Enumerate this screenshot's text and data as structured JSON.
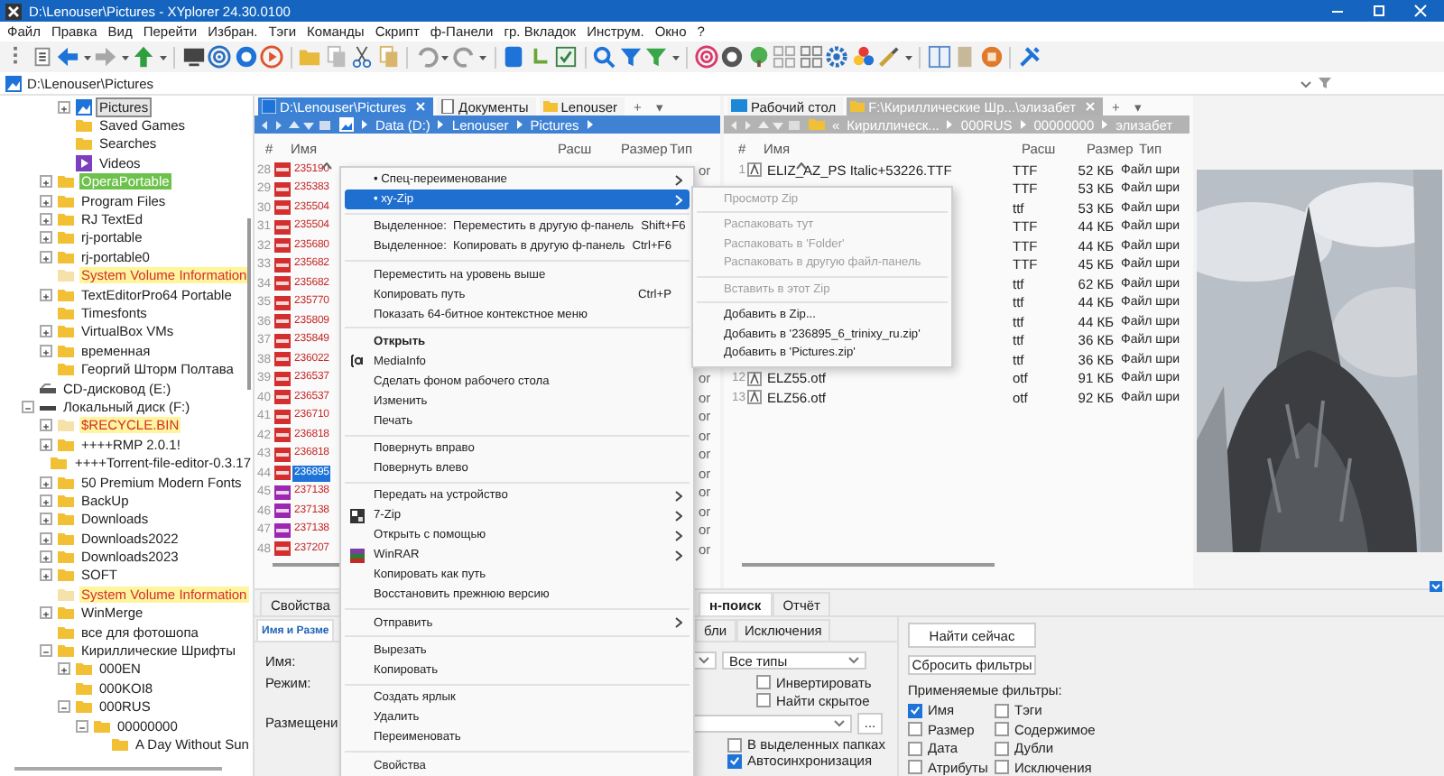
{
  "window": {
    "title": "D:\\Lenouser\\Pictures - XYplorer 24.30.0100"
  },
  "menu": [
    "Файл",
    "Правка",
    "Вид",
    "Перейти",
    "Избран.",
    "Тэги",
    "Команды",
    "Скрипт",
    "ф-Панели",
    "гр. Вкладок",
    "Инструм.",
    "Окно",
    "?"
  ],
  "address": "D:\\Lenouser\\Pictures",
  "tree": [
    {
      "children": [
        {
          "children": [
            {
              "label": "Pictures",
              "kind": "pictures",
              "expanded": false,
              "selected": true
            },
            {
              "label": "Saved Games",
              "kind": "folder",
              "selected": false
            },
            {
              "label": "Searches",
              "kind": "folder",
              "selected": false
            },
            {
              "label": "Videos",
              "kind": "videos",
              "selected": false
            }
          ]
        },
        {
          "label": "OperaPortable",
          "kind": "labeled",
          "color": "#6cc24a",
          "expanded": false,
          "selected": false
        },
        {
          "label": "Program Files",
          "kind": "folder",
          "expanded": false,
          "selected": false
        },
        {
          "label": "RJ TextEd",
          "kind": "folder",
          "expanded": false,
          "selected": false
        },
        {
          "label": "rj-portable",
          "kind": "folder",
          "expanded": false,
          "selected": false
        },
        {
          "label": "rj-portable0",
          "kind": "folder",
          "expanded": false,
          "selected": false
        },
        {
          "label": "System Volume Information",
          "kind": "system",
          "color": "#fff59d",
          "selected": false
        },
        {
          "label": "TextEditorPro64 Portable",
          "kind": "folder",
          "expanded": false,
          "selected": false
        },
        {
          "label": "Timesfonts",
          "kind": "folder",
          "selected": false
        },
        {
          "label": "VirtualBox VMs",
          "kind": "folder",
          "expanded": false,
          "selected": false
        },
        {
          "label": "временная",
          "kind": "folder",
          "expanded": false,
          "selected": false
        },
        {
          "label": "Георгий Шторм Полтава",
          "kind": "folder",
          "selected": false
        }
      ]
    },
    {
      "label": "CD-дисковод (E:)",
      "kind": "cd",
      "selected": false
    },
    {
      "label": "Локальный диск (F:)",
      "kind": "disk",
      "expanded": true,
      "selected": false,
      "children": [
        {
          "label": "$RECYCLE.BIN",
          "kind": "system",
          "color": "#fff59d",
          "expanded": false,
          "selected": false
        },
        {
          "label": "++++RMP 2.0.1!",
          "kind": "folder",
          "expanded": false,
          "selected": false
        },
        {
          "label": "++++Torrent-file-editor-0.3.17",
          "kind": "folder",
          "selected": false
        },
        {
          "label": "50 Premium Modern Fonts",
          "kind": "folder",
          "expanded": false,
          "selected": false
        },
        {
          "label": "BackUp",
          "kind": "folder",
          "expanded": false,
          "selected": false
        },
        {
          "label": "Downloads",
          "kind": "folder",
          "expanded": false,
          "selected": false
        },
        {
          "label": "Downloads2022",
          "kind": "folder",
          "expanded": false,
          "selected": false
        },
        {
          "label": "Downloads2023",
          "kind": "folder",
          "expanded": false,
          "selected": false
        },
        {
          "label": "SOFT",
          "kind": "folder",
          "expanded": false,
          "selected": false
        },
        {
          "label": "System Volume Information",
          "kind": "system",
          "color": "#fff59d",
          "selected": false
        },
        {
          "label": "WinMerge",
          "kind": "folder",
          "expanded": false,
          "selected": false
        },
        {
          "label": "все для фотошопа",
          "kind": "folder",
          "selected": false
        },
        {
          "label": "Кириллические Шрифты",
          "kind": "folder",
          "expanded": true,
          "selected": false,
          "children": [
            {
              "label": "000EN",
              "kind": "folder",
              "expanded": false,
              "selected": false
            },
            {
              "label": "000KOI8",
              "kind": "folder",
              "selected": false
            },
            {
              "label": "000RUS",
              "kind": "folder",
              "expanded": true,
              "selected": false,
              "children": [
                {
                  "label": "00000000",
                  "kind": "folder",
                  "expanded": true,
                  "selected": false,
                  "children": [
                    {
                      "label": "A Day Without Sun",
                      "kind": "folder",
                      "selected": false
                    }
                  ]
                }
              ]
            }
          ]
        }
      ]
    }
  ],
  "left_pane": {
    "tabs": [
      {
        "label": "D:\\Lenouser\\Pictures",
        "selected": true
      },
      {
        "label": "Документы",
        "selected": false
      },
      {
        "label": "Lenouser",
        "selected": false
      }
    ],
    "new_tab": "+",
    "tab_menu": "▾",
    "breadcrumb": {
      "crumbs": [
        "Data (D:)",
        "Lenouser",
        "Pictures"
      ],
      "trailing_arrow": true
    },
    "columns": [
      "#",
      "Имя",
      "Расш",
      "Размер",
      "Тип"
    ],
    "rows": [
      {
        "num": "28",
        "name": "235190",
        "color": "#d32f2f",
        "type": "or",
        "selected": false
      },
      {
        "num": "29",
        "name": "235383",
        "color": "#d32f2f",
        "selected": false
      },
      {
        "num": "30",
        "name": "235504",
        "color": "#d32f2f",
        "selected": false
      },
      {
        "num": "31",
        "name": "235504",
        "color": "#d32f2f",
        "selected": false
      },
      {
        "num": "32",
        "name": "235680",
        "color": "#d32f2f",
        "selected": false
      },
      {
        "num": "33",
        "name": "235682",
        "color": "#d32f2f",
        "selected": false
      },
      {
        "num": "34",
        "name": "235682",
        "color": "#d32f2f",
        "selected": false
      },
      {
        "num": "35",
        "name": "235770",
        "color": "#d32f2f",
        "selected": false
      },
      {
        "num": "36",
        "name": "235809",
        "color": "#d32f2f",
        "selected": false
      },
      {
        "num": "37",
        "name": "235849",
        "color": "#d32f2f",
        "selected": false
      },
      {
        "num": "38",
        "name": "236022",
        "color": "#d32f2f",
        "selected": false
      },
      {
        "num": "39",
        "name": "236537",
        "color": "#d32f2f",
        "type": "or",
        "selected": false
      },
      {
        "num": "40",
        "name": "236537",
        "color": "#d32f2f",
        "type": "or",
        "selected": false
      },
      {
        "num": "41",
        "name": "236710",
        "color": "#d32f2f",
        "type": "or",
        "selected": false
      },
      {
        "num": "42",
        "name": "236818",
        "color": "#d32f2f",
        "type": "or",
        "selected": false
      },
      {
        "num": "43",
        "name": "236818",
        "color": "#d32f2f",
        "type": "or",
        "selected": false
      },
      {
        "num": "44",
        "name": "236895",
        "color": "#d32f2f",
        "type": "or",
        "selected": true
      },
      {
        "num": "45",
        "name": "237138",
        "color": "#9c27b0",
        "type": "or",
        "selected": false
      },
      {
        "num": "46",
        "name": "237138",
        "color": "#9c27b0",
        "type": "or",
        "selected": false
      },
      {
        "num": "47",
        "name": "237138",
        "color": "#9c27b0",
        "type": "or",
        "selected": false
      },
      {
        "num": "48",
        "name": "237207",
        "color": "#d32f2f",
        "type": "or",
        "selected": false
      }
    ]
  },
  "right_pane": {
    "tabs": [
      {
        "label": "Рабочий стол",
        "selected": false
      },
      {
        "label": "F:\\Кириллические Шр...\\элизабет",
        "selected": true
      }
    ],
    "new_tab": "+",
    "tab_menu": "▾",
    "breadcrumb": {
      "overflow": "«",
      "crumbs": [
        "Кириллическ...",
        "000RUS",
        "00000000",
        "элизабет"
      ],
      "trailing_arrow": false
    },
    "columns": [
      "#",
      "Имя",
      "Расш",
      "Размер",
      "Тип"
    ],
    "rows": [
      {
        "num": "1",
        "name": "ELIZ_AZ_PS Italic+53226.TTF",
        "ext": "TTF",
        "size": "52 КБ",
        "type": "Файл шри"
      },
      {
        "ext": "TTF",
        "size": "53 КБ",
        "type": "Файл шри"
      },
      {
        "ext": "ttf",
        "size": "53 КБ",
        "type": "Файл шри"
      },
      {
        "ext": "TTF",
        "size": "44 КБ",
        "type": "Файл шри"
      },
      {
        "ext": "TTF",
        "size": "44 КБ",
        "type": "Файл шри"
      },
      {
        "ext": "TTF",
        "size": "45 КБ",
        "type": "Файл шри"
      },
      {
        "ext": "ttf",
        "size": "62 КБ",
        "type": "Файл шри"
      },
      {
        "ext": "ttf",
        "size": "44 КБ",
        "type": "Файл шри"
      },
      {
        "ext": "ttf",
        "size": "44 КБ",
        "type": "Файл шри"
      },
      {
        "ext": "ttf",
        "size": "36 КБ",
        "type": "Файл шри"
      },
      {
        "ext": "ttf",
        "size": "36 КБ",
        "type": "Файл шри"
      },
      {
        "num": "12",
        "name": "ELZ55.otf",
        "ext": "otf",
        "size": "91 КБ",
        "type": "Файл шри"
      },
      {
        "num": "13",
        "name": "ELZ56.otf",
        "ext": "otf",
        "size": "92 КБ",
        "type": "Файл шри"
      }
    ]
  },
  "bottom_panel": {
    "tabs": [
      {
        "label": "Свойства",
        "selected": false
      },
      {
        "label": "н-поиск",
        "selected": true
      },
      {
        "label": "Отчёт",
        "selected": false
      }
    ],
    "subtabs": [
      {
        "label": "Имя и Разме",
        "selected": true
      },
      {
        "label": "бли",
        "selected": false
      },
      {
        "label": "Исключения",
        "selected": false
      }
    ],
    "labels": [
      "Имя:",
      "Режим:",
      "Размещени"
    ],
    "type_select": "Все типы",
    "options": [
      {
        "label": "Инвертировать",
        "checked": false
      },
      {
        "label": "Найти скрытое",
        "checked": false
      }
    ],
    "browse_button": "...",
    "location_options": [
      {
        "label": "В выделенных папках",
        "checked": false
      },
      {
        "label": "Автосинхронизация",
        "checked": true
      }
    ],
    "buttons": [
      "Найти сейчас",
      "Сбросить фильтры"
    ],
    "filters_title": "Применяемые фильтры:",
    "filters": [
      {
        "label": "Имя",
        "checked": true
      },
      {
        "label": "Тэги",
        "checked": false
      },
      {
        "label": "Размер",
        "checked": false
      },
      {
        "label": "Содержимое",
        "checked": false
      },
      {
        "label": "Дата",
        "checked": false
      },
      {
        "label": "Дубли",
        "checked": false
      },
      {
        "label": "Атрибуты",
        "checked": false
      },
      {
        "label": "Исключения",
        "checked": false
      }
    ]
  },
  "context_menu": {
    "items": [
      {
        "kind": "item",
        "label": "• Спец-переименование",
        "submenu": true,
        "selected": false
      },
      {
        "kind": "item",
        "label": "• xy-Zip",
        "submenu": true,
        "selected": true
      },
      {
        "kind": "separator"
      },
      {
        "kind": "item",
        "label": "Выделенное:  Переместить в другую ф-панель",
        "shortcut": "Shift+F6",
        "submenu": false,
        "selected": false
      },
      {
        "kind": "item",
        "label": "Выделенное:  Копировать в другую ф-панель",
        "shortcut": "Ctrl+F6",
        "submenu": false,
        "selected": false
      },
      {
        "kind": "separator"
      },
      {
        "kind": "item",
        "label": "Переместить на уровень выше",
        "submenu": false,
        "selected": false
      },
      {
        "kind": "item",
        "label": "Копировать путь",
        "shortcut": "Ctrl+P",
        "submenu": false,
        "selected": false
      },
      {
        "kind": "item",
        "label": "Показать 64-битное контекстное меню",
        "submenu": false,
        "selected": false
      },
      {
        "kind": "separator"
      },
      {
        "kind": "default",
        "label": "Открыть",
        "submenu": false,
        "selected": false
      },
      {
        "kind": "with-icon",
        "label": "MediaInfo",
        "submenu": false,
        "selected": false
      },
      {
        "kind": "item",
        "label": "Сделать фоном рабочего стола",
        "submenu": false,
        "selected": false
      },
      {
        "kind": "item",
        "label": "Изменить",
        "submenu": false,
        "selected": false
      },
      {
        "kind": "item",
        "label": "Печать",
        "submenu": false,
        "selected": false
      },
      {
        "kind": "separator"
      },
      {
        "kind": "item",
        "label": "Повернуть вправо",
        "submenu": false,
        "selected": false
      },
      {
        "kind": "item",
        "label": "Повернуть влево",
        "submenu": false,
        "selected": false
      },
      {
        "kind": "separator"
      },
      {
        "kind": "item",
        "label": "Передать на устройство",
        "submenu": true,
        "selected": false
      },
      {
        "kind": "with-icon",
        "label": "7-Zip",
        "submenu": true,
        "selected": false
      },
      {
        "kind": "item",
        "label": "Открыть с помощью",
        "submenu": true,
        "selected": false
      },
      {
        "kind": "with-icon",
        "label": "WinRAR",
        "submenu": true,
        "selected": false
      },
      {
        "kind": "item",
        "label": "Копировать как путь",
        "submenu": false,
        "selected": false
      },
      {
        "kind": "item",
        "label": "Восстановить прежнюю версию",
        "submenu": false,
        "selected": false
      },
      {
        "kind": "separator"
      },
      {
        "kind": "item",
        "label": "Отправить",
        "submenu": true,
        "selected": false
      },
      {
        "kind": "separator"
      },
      {
        "kind": "item",
        "label": "Вырезать",
        "submenu": false,
        "selected": false
      },
      {
        "kind": "item",
        "label": "Копировать",
        "submenu": false,
        "selected": false
      },
      {
        "kind": "separator"
      },
      {
        "kind": "item",
        "label": "Создать ярлык",
        "submenu": false,
        "selected": false
      },
      {
        "kind": "item",
        "label": "Удалить",
        "submenu": false,
        "selected": false
      },
      {
        "kind": "item",
        "label": "Переименовать",
        "submenu": false,
        "selected": false
      },
      {
        "kind": "separator"
      },
      {
        "kind": "item",
        "label": "Свойства",
        "submenu": false,
        "selected": false
      }
    ]
  },
  "submenu": {
    "items": [
      {
        "kind": "item",
        "label": "Просмотр Zip",
        "disabled": true
      },
      {
        "kind": "separator"
      },
      {
        "kind": "item",
        "label": "Распаковать тут",
        "disabled": true
      },
      {
        "kind": "item",
        "label": "Распаковать в 'Folder'",
        "disabled": true
      },
      {
        "kind": "item",
        "label": "Распаковать в другую файл-панель",
        "disabled": true
      },
      {
        "kind": "separator"
      },
      {
        "kind": "item",
        "label": "Вставить в этот Zip",
        "disabled": true
      },
      {
        "kind": "separator"
      },
      {
        "kind": "item",
        "label": "Добавить в Zip...",
        "disabled": false
      },
      {
        "kind": "item",
        "label": "Добавить в '236895_6_trinixy_ru.zip'",
        "disabled": false
      },
      {
        "kind": "item",
        "label": "Добавить в 'Pictures.zip'",
        "disabled": false
      }
    ]
  }
}
